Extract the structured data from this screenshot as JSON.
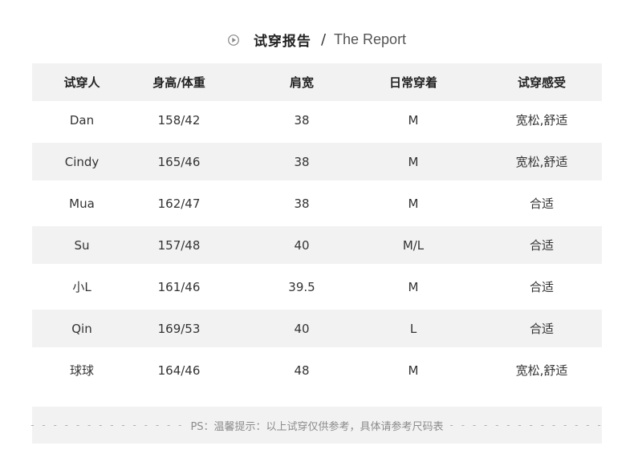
{
  "title": {
    "cn": "试穿报告",
    "separator": "/",
    "en": "The Report",
    "icon": "play-circle-icon"
  },
  "table": {
    "headers": [
      "试穿人",
      "身高/体重",
      "肩宽",
      "日常穿着",
      "试穿感受"
    ],
    "rows": [
      [
        "Dan",
        "158/42",
        "38",
        "M",
        "宽松,舒适"
      ],
      [
        "Cindy",
        "165/46",
        "38",
        "M",
        "宽松,舒适"
      ],
      [
        "Mua",
        "162/47",
        "38",
        "M",
        "合适"
      ],
      [
        "Su",
        "157/48",
        "40",
        "M/L",
        "合适"
      ],
      [
        "小L",
        "161/46",
        "39.5",
        "M",
        "合适"
      ],
      [
        "Qin",
        "169/53",
        "40",
        "L",
        "合适"
      ],
      [
        "球球",
        "164/46",
        "48",
        "M",
        "宽松,舒适"
      ]
    ]
  },
  "footer": {
    "dashes_left": "- - - - - - - - - - - - - -",
    "note": "PS：温馨提示：以上试穿仅供参考，具体请参考尺码表",
    "dashes_right": "- - - - - - - - - - - - - -"
  },
  "colors": {
    "band": "#f2f2f2",
    "text": "#333333",
    "muted": "#999999"
  }
}
